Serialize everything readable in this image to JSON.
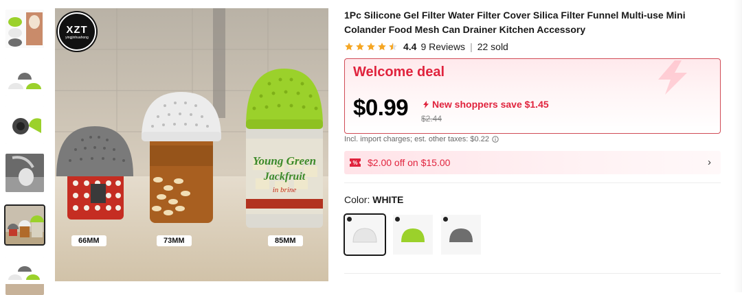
{
  "product": {
    "title": "1Pc Silicone Gel Filter Water Filter Cover Silica Filter Funnel Multi-use Mini Colander Food Mesh Can Drainer Kitchen Accessory",
    "rating": "4.4",
    "rating_value": 4.4,
    "reviews": "9 Reviews",
    "sold": "22 sold"
  },
  "gallery": {
    "brand_logo": "XZT",
    "brand_sub": "yingjinhuahong",
    "size_tags": [
      "66MM",
      "73MM",
      "85MM"
    ],
    "jar_label": [
      "Young Green",
      "Jackfruit",
      "in brine"
    ],
    "thumbnails": [
      "thumb-1",
      "thumb-2",
      "thumb-3",
      "thumb-4",
      "thumb-5",
      "thumb-6"
    ],
    "active_thumbnail": 4
  },
  "deal": {
    "title": "Welcome deal",
    "price": "$0.99",
    "save_text": "New shoppers save $1.45",
    "original_price": "$2.44"
  },
  "taxes": "Incl. import charges; est. other taxes: $0.22",
  "coupon": {
    "text": "$2.00 off on $15.00",
    "icon": "coupon-icon"
  },
  "color": {
    "label": "Color: ",
    "value": "WHITE",
    "options": [
      "white",
      "green",
      "gray"
    ],
    "selected": 0
  },
  "colors": {
    "accent": "#e0233d",
    "star": "#f5a623",
    "green": "#9bd12b",
    "gray_filter": "#6e6e6e",
    "white_filter": "#e8e8e8"
  }
}
